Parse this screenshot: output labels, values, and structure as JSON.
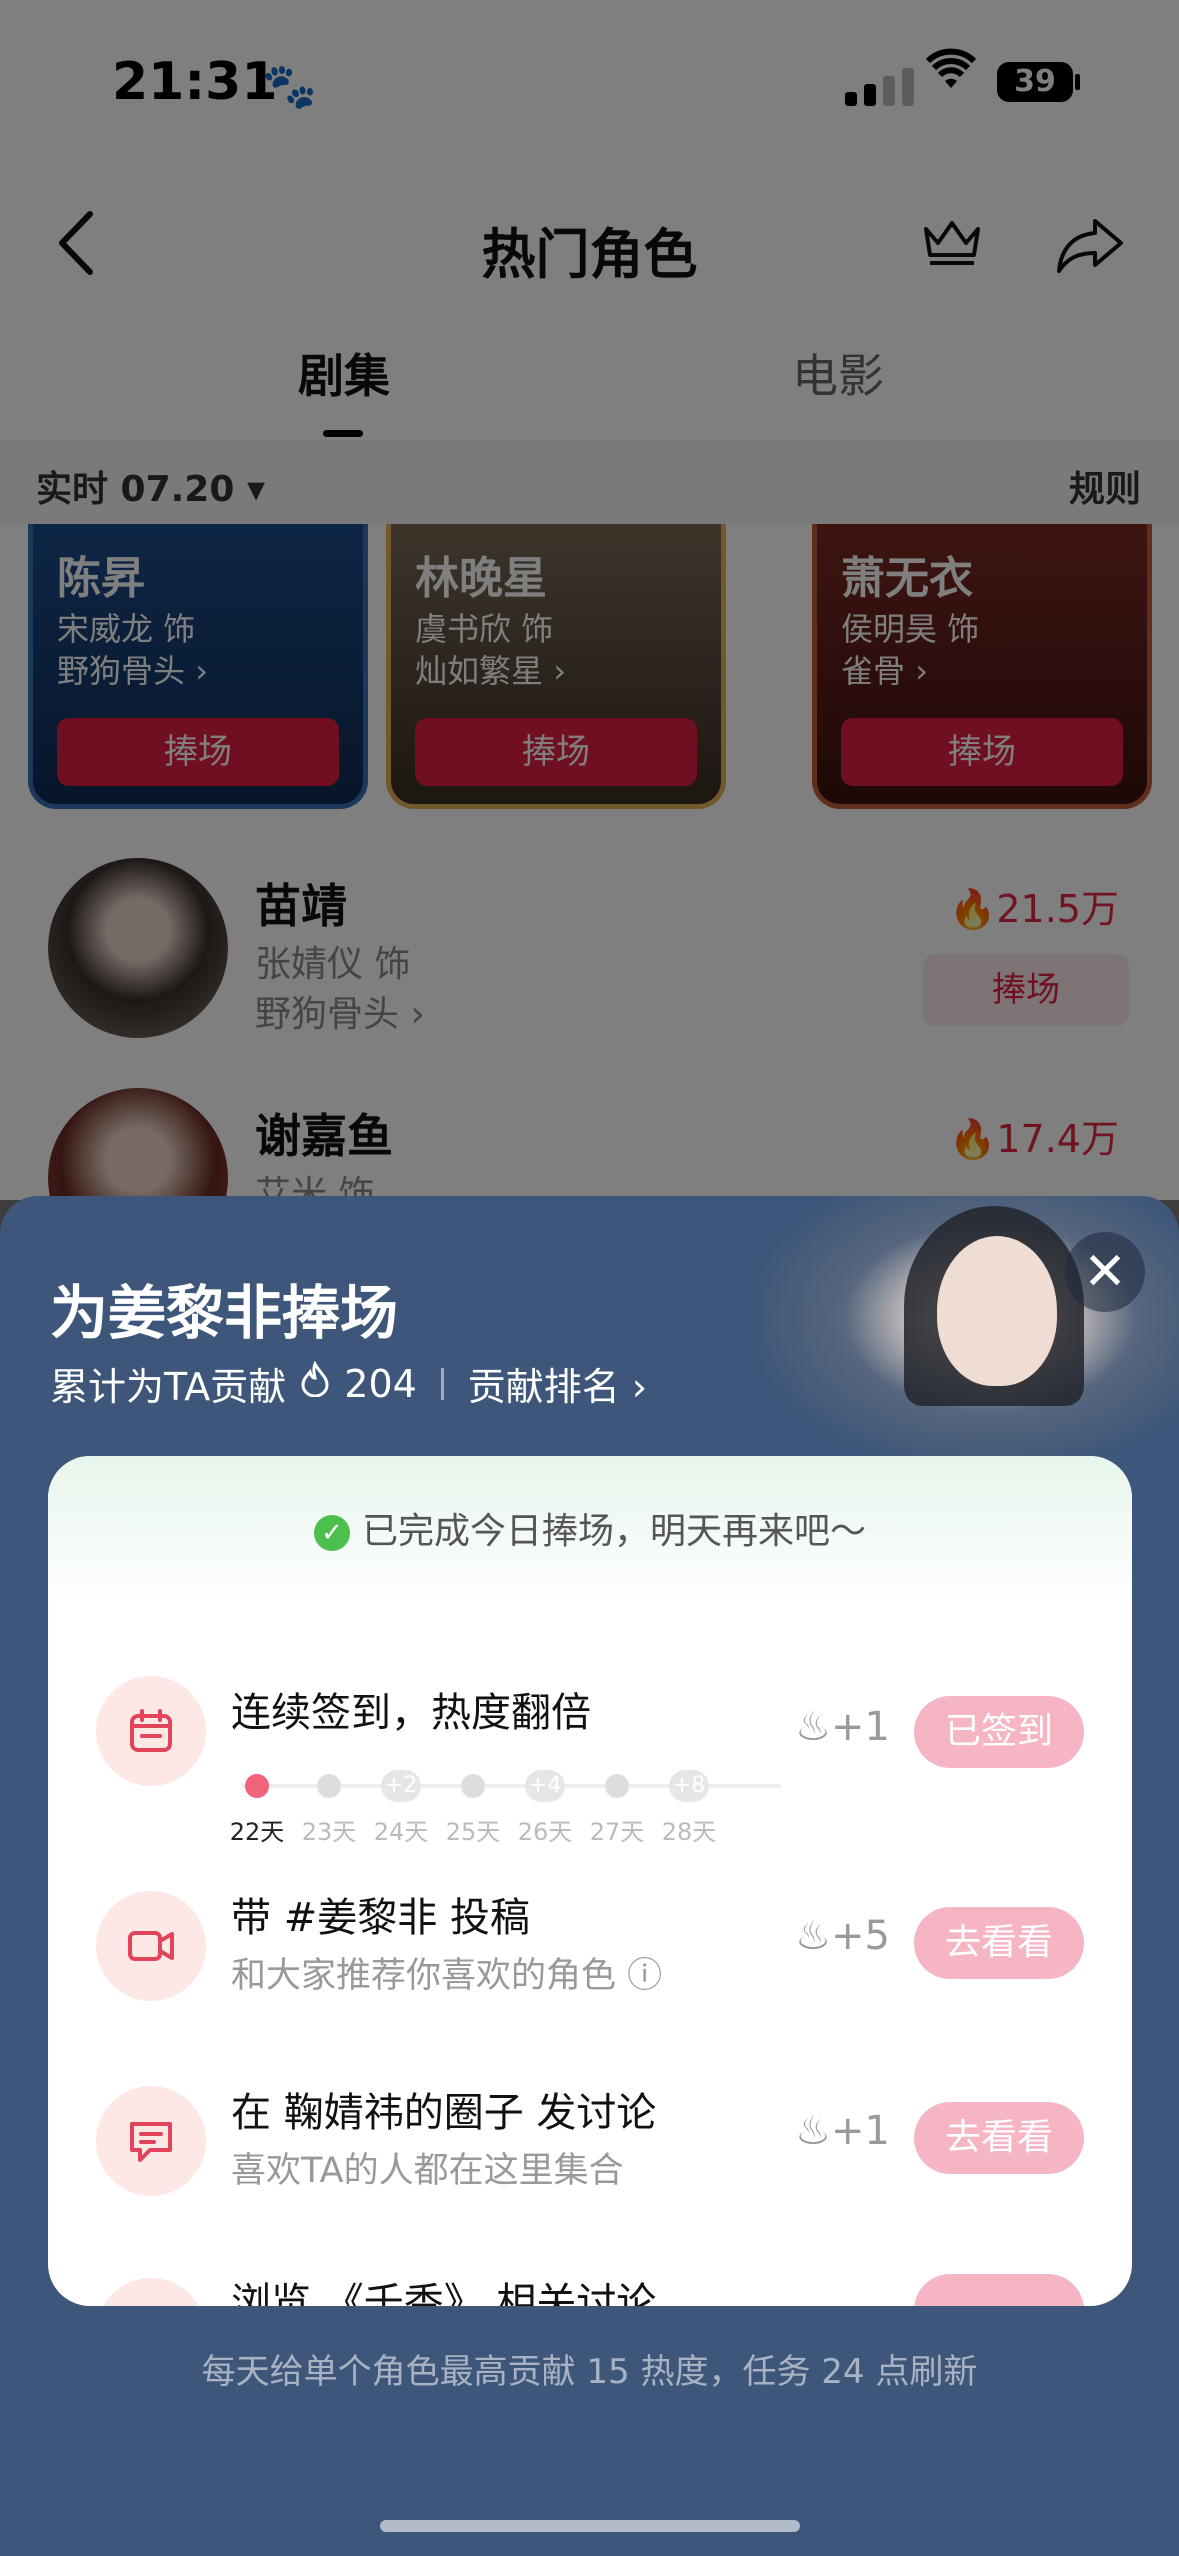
{
  "status_bar": {
    "time": "21:31",
    "battery": "39"
  },
  "header": {
    "title": "热门角色"
  },
  "tabs": [
    {
      "label": "剧集",
      "active": true
    },
    {
      "label": "电影",
      "active": false
    }
  ],
  "filter": {
    "date": "实时 07.20",
    "rules": "规则"
  },
  "top_cards": [
    {
      "name": "陈昇",
      "actor": "宋威龙 饰",
      "drama": "野狗骨头",
      "button": "捧场"
    },
    {
      "name": "林晚星",
      "actor": "虞书欣 饰",
      "drama": "灿如繁星",
      "button": "捧场"
    },
    {
      "name": "萧无衣",
      "actor": "侯明昊 饰",
      "drama": "雀骨",
      "button": "捧场"
    }
  ],
  "ranking_rows": [
    {
      "name": "苗靖",
      "actor": "张婧仪 饰",
      "drama": "野狗骨头",
      "heat": "21.5万",
      "button": "捧场"
    },
    {
      "name": "谢嘉鱼",
      "actor": "艾米 饰",
      "heat": "17.4万"
    }
  ],
  "sheet": {
    "title": "为姜黎非捧场",
    "contribution_label": "累计为TA贡献",
    "contribution_value": "204",
    "rank_link": "贡献排名",
    "done_message": "已完成今日捧场，明天再来吧～",
    "tasks": [
      {
        "title": "连续签到，热度翻倍",
        "reward": "+1",
        "button": "已签到",
        "days": [
          {
            "label": "22天",
            "bonus": ""
          },
          {
            "label": "23天",
            "bonus": ""
          },
          {
            "label": "24天",
            "bonus": "+2"
          },
          {
            "label": "25天",
            "bonus": ""
          },
          {
            "label": "26天",
            "bonus": "+4"
          },
          {
            "label": "27天",
            "bonus": ""
          },
          {
            "label": "28天",
            "bonus": "+8"
          }
        ]
      },
      {
        "title": "带 #姜黎非 投稿",
        "subtitle": "和大家推荐你喜欢的角色",
        "reward": "+5",
        "button": "去看看"
      },
      {
        "title": "在 鞠婧祎的圈子 发讨论",
        "subtitle": "喜欢TA的人都在这里集合",
        "reward": "+1",
        "button": "去看看"
      },
      {
        "title": "浏览 《千香》 相关讨论"
      }
    ],
    "footer_note": "每天给单个角色最高贡献 15 热度，任务 24 点刷新"
  },
  "colors": {
    "accent": "#e01e44",
    "sheet_bg": "#3e5679",
    "button_pink": "#f5b5c5"
  }
}
